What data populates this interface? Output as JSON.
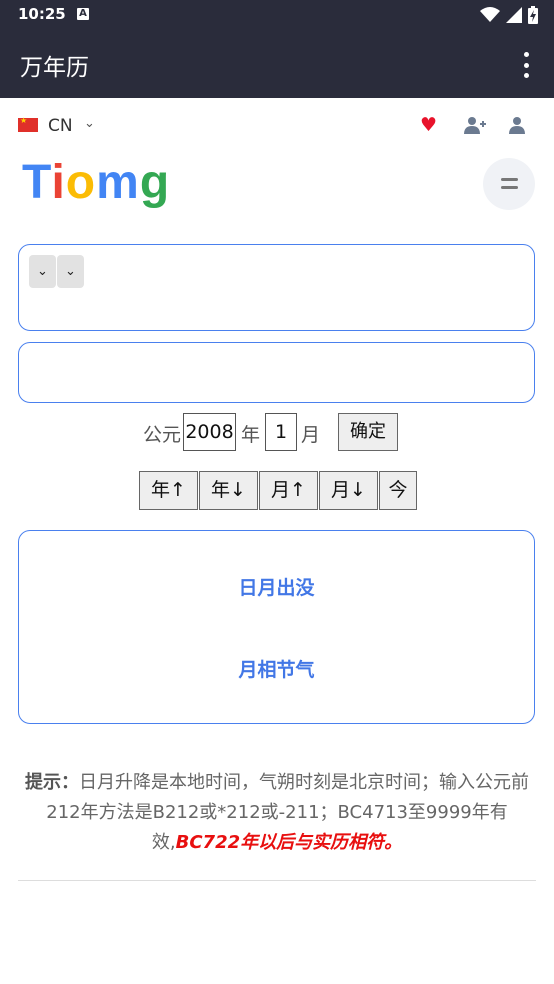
{
  "status": {
    "time": "10:25",
    "a_icon": "A"
  },
  "app_bar": {
    "title": "万年历"
  },
  "topbar": {
    "lang": "CN"
  },
  "logo": {
    "letters": [
      "T",
      "i",
      "o",
      "m",
      "g"
    ]
  },
  "date_form": {
    "prefix": "公元",
    "year_value": "2008",
    "year_label": "年",
    "month_value": "1",
    "month_label": "月",
    "confirm": "确定"
  },
  "nav": {
    "year_up": "年↑",
    "year_down": "年↓",
    "month_up": "月↑",
    "month_down": "月↓",
    "today": "今"
  },
  "links": {
    "sun_moon": "日月出没",
    "moon_phase": "月相节气"
  },
  "tip": {
    "label": "提示：",
    "text": "日月升降是本地时间，气朔时刻是北京时间；输入公元前212年方法是B212或*212或-211；BC4713至9999年有效,",
    "emphasis": "BC722年以后与实历相符。"
  },
  "colors": {
    "app_bar": "#2a2c3b",
    "box_border": "#4a80ee",
    "link": "#4277e6",
    "heart": "#e8132b",
    "emphasis": "#e80f0f"
  }
}
